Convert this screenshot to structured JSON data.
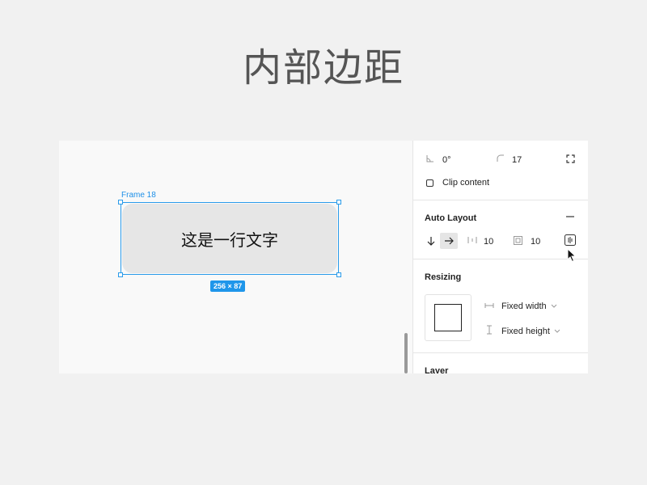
{
  "slide": {
    "title": "内部边距"
  },
  "canvas": {
    "frame_label": "Frame 18",
    "frame_text": "这是一行文字",
    "dimension_badge": "256 × 87"
  },
  "panel": {
    "rotation": "0°",
    "corner_radius": "17",
    "clip_content": {
      "label": "Clip content",
      "checked": false
    },
    "auto_layout": {
      "title": "Auto Layout",
      "direction": "horizontal",
      "spacing_between": "10",
      "padding": "10"
    },
    "resizing": {
      "title": "Resizing",
      "width_mode": "Fixed width",
      "height_mode": "Fixed height"
    },
    "layer_title": "Layer"
  },
  "icons": {
    "angle": "angle-icon",
    "corner": "corner-radius-icon",
    "expand": "independent-corners-icon",
    "remove": "minus-icon",
    "down": "arrow-down-icon",
    "right": "arrow-right-icon",
    "spacing": "spacing-between-icon",
    "padding": "padding-icon",
    "alignment": "alignment-icon",
    "width": "horizontal-resize-icon",
    "height": "vertical-resize-icon",
    "cursor": "cursor-arrow-icon"
  },
  "colors": {
    "selection": "#2a9bea",
    "badge": "#1f96ea"
  }
}
